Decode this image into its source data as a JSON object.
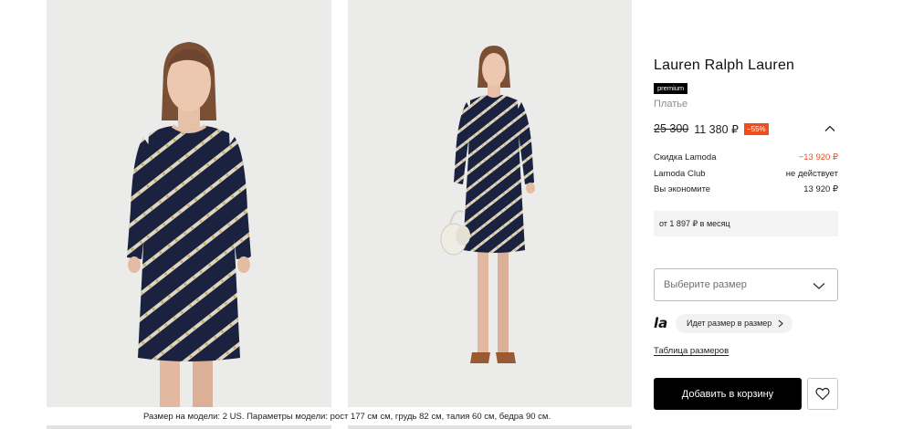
{
  "gallery": {
    "photos": [
      {
        "alt": "photo-front-closeup"
      },
      {
        "alt": "photo-full-length-with-bag"
      }
    ],
    "caption": "Размер на модели: 2 US. Параметры модели: рост 177 см см, грудь 82 см, талия 60 см, бедра 90 см."
  },
  "product": {
    "brand": "Lauren Ralph Lauren",
    "badge": "premium",
    "type": "Платье",
    "old_price": "25 300",
    "new_price": "11 380 ₽",
    "discount": "−55%"
  },
  "price_breakdown": [
    {
      "label": "Скидка Lamoda",
      "value": "−13 920 ₽",
      "accent": true
    },
    {
      "label": "Lamoda Club",
      "value": "не действует",
      "accent": false
    },
    {
      "label": "Вы экономите",
      "value": "13 920 ₽",
      "accent": false
    }
  ],
  "installment": "от 1 897 ₽ в месяц",
  "size_select": {
    "placeholder": "Выберите размер"
  },
  "fit": {
    "logo": "la",
    "label": "Идет размер в размер"
  },
  "size_table_link": "Таблица размеров",
  "add_to_cart": "Добавить в корзину",
  "colors": {
    "accent": "#f24c1b",
    "primary_button": "#000000",
    "photo_background": "#e9e9e9",
    "dress": "#1b2240"
  },
  "icons": {
    "collapse": "chevron-up-icon",
    "dropdown": "chevron-down-icon",
    "fit_more": "chevron-right-icon",
    "favorite": "heart-icon"
  }
}
